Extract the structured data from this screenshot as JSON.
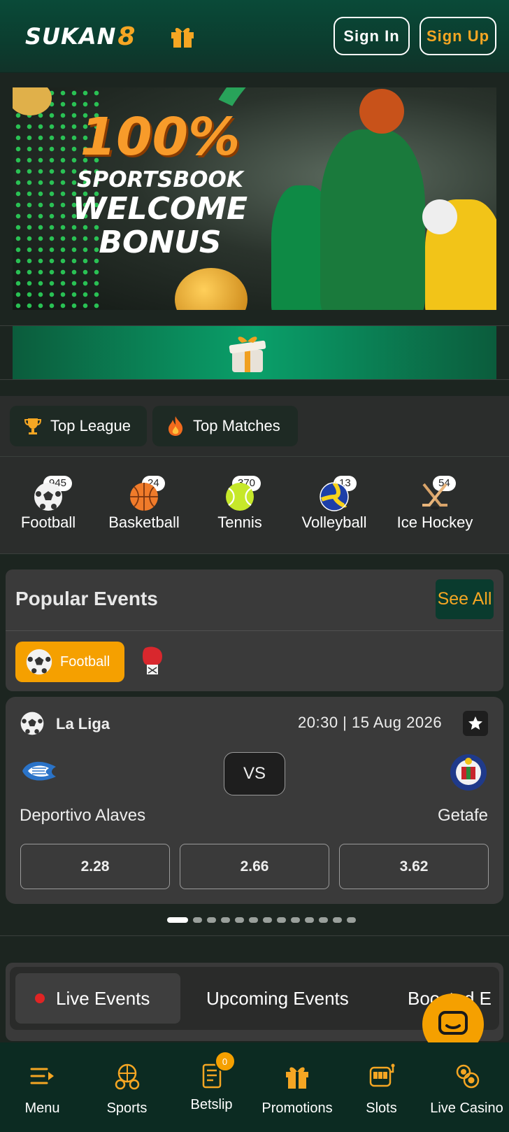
{
  "header": {
    "logo_text": "SUKAN",
    "logo_mark": "8",
    "signin_label": "Sign In",
    "signup_label": "Sign Up"
  },
  "banner": {
    "headline": "100%",
    "line1": "SPORTSBOOK",
    "line2": "WELCOME",
    "line3": "BONUS"
  },
  "quick_tabs": [
    {
      "label": "Top League",
      "icon": "trophy-icon"
    },
    {
      "label": "Top Matches",
      "icon": "fire-icon"
    }
  ],
  "sports": [
    {
      "label": "Football",
      "count": "945",
      "icon": "soccer-ball-icon"
    },
    {
      "label": "Basketball",
      "count": "24",
      "icon": "basketball-icon"
    },
    {
      "label": "Tennis",
      "count": "370",
      "icon": "tennis-ball-icon"
    },
    {
      "label": "Volleyball",
      "count": "13",
      "icon": "volleyball-icon"
    },
    {
      "label": "Ice Hockey",
      "count": "54",
      "icon": "hockey-sticks-icon"
    }
  ],
  "popular_events": {
    "title": "Popular Events",
    "see_all": "See All",
    "active_filter": "Football",
    "event": {
      "league": "La Liga",
      "time": "20:30 | 15 Aug 2026",
      "vs": "VS",
      "home_team": "Deportivo Alaves",
      "away_team": "Getafe",
      "odds": [
        "2.28",
        "2.66",
        "3.62"
      ]
    },
    "pager_count": 13,
    "pager_active": 0
  },
  "live_tabs": [
    "Live Events",
    "Upcoming Events",
    "Boosted E"
  ],
  "bottom_nav": [
    {
      "label": "Menu",
      "icon": "menu-icon"
    },
    {
      "label": "Sports",
      "icon": "sports-icon"
    },
    {
      "label": "Betslip",
      "icon": "betslip-icon",
      "badge": "0"
    },
    {
      "label": "Promotions",
      "icon": "gift-icon"
    },
    {
      "label": "Slots",
      "icon": "slot-machine-icon"
    },
    {
      "label": "Live Casino",
      "icon": "casino-chips-icon"
    }
  ],
  "colors": {
    "accent": "#f5a000",
    "header_bg": "#0a4a38",
    "card_bg": "#3a3a3a",
    "nav_bg": "#0c2b22"
  }
}
